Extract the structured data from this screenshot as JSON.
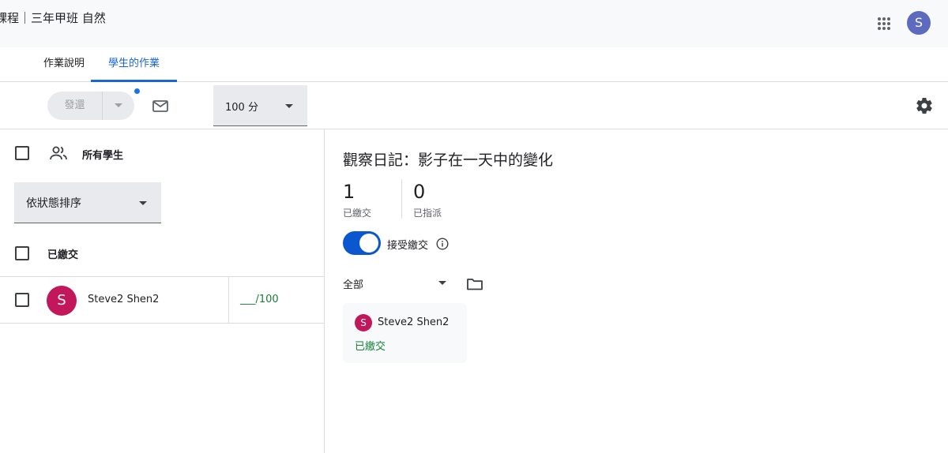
{
  "header": {
    "course_title": "課程｜三年甲班 自然",
    "apps_icon": "apps-grid-icon",
    "account_initial": "S",
    "account_color": "#5c6bc0"
  },
  "tabs": [
    {
      "label": "作業說明",
      "active": false
    },
    {
      "label": "學生的作業",
      "active": true
    }
  ],
  "toolbar": {
    "return_label": "發還",
    "return_enabled": false,
    "mail_icon": "mail-icon",
    "points_value": "100 分",
    "settings_icon": "gear-icon"
  },
  "roster": {
    "all_students_label": "所有學生",
    "sort_value": "依狀態排序",
    "section_label": "已繳交",
    "students": [
      {
        "initial": "S",
        "name": "Steve2 Shen2",
        "grade": "___/100",
        "avatar_color": "#c2185b"
      }
    ]
  },
  "assignment": {
    "title": "觀察日記：影子在一天中的變化",
    "stats": [
      {
        "count": "1",
        "label": "已繳交"
      },
      {
        "count": "0",
        "label": "已指派"
      }
    ],
    "accepting_label": "接受繳交",
    "accepting": true,
    "filter_value": "全部",
    "cards": [
      {
        "initial": "S",
        "name": "Steve2 Shen2",
        "status": "已繳交"
      }
    ]
  },
  "colors": {
    "accent": "#1967d2",
    "toggle": "#0b57d0",
    "turned_in": "#188038"
  }
}
